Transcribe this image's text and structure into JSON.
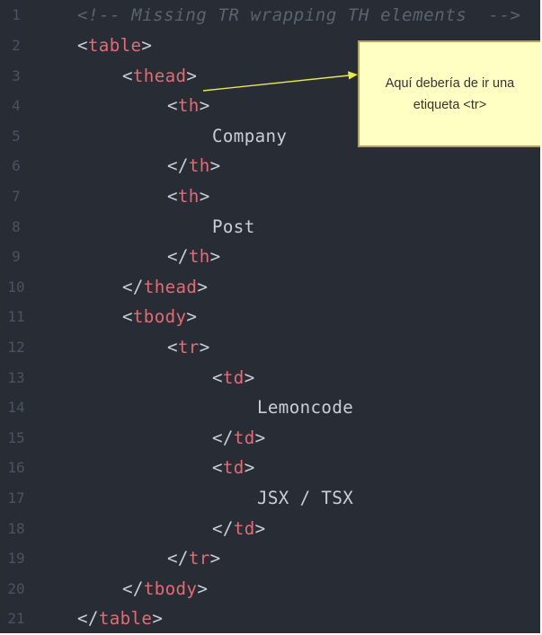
{
  "editor": {
    "lines": [
      {
        "n": "1",
        "indent": 0,
        "kind": "comment",
        "text": "<!-- Missing TR wrapping TH elements  -->"
      },
      {
        "n": "2",
        "indent": 0,
        "kind": "open",
        "tag": "table"
      },
      {
        "n": "3",
        "indent": 1,
        "kind": "open",
        "tag": "thead"
      },
      {
        "n": "4",
        "indent": 2,
        "kind": "open",
        "tag": "th"
      },
      {
        "n": "5",
        "indent": 3,
        "kind": "text",
        "text": "Company"
      },
      {
        "n": "6",
        "indent": 2,
        "kind": "close",
        "tag": "th"
      },
      {
        "n": "7",
        "indent": 2,
        "kind": "open",
        "tag": "th"
      },
      {
        "n": "8",
        "indent": 3,
        "kind": "text",
        "text": "Post"
      },
      {
        "n": "9",
        "indent": 2,
        "kind": "close",
        "tag": "th"
      },
      {
        "n": "10",
        "indent": 1,
        "kind": "close",
        "tag": "thead"
      },
      {
        "n": "11",
        "indent": 1,
        "kind": "open",
        "tag": "tbody"
      },
      {
        "n": "12",
        "indent": 2,
        "kind": "open",
        "tag": "tr"
      },
      {
        "n": "13",
        "indent": 3,
        "kind": "open",
        "tag": "td"
      },
      {
        "n": "14",
        "indent": 4,
        "kind": "text",
        "text": "Lemoncode"
      },
      {
        "n": "15",
        "indent": 3,
        "kind": "close",
        "tag": "td"
      },
      {
        "n": "16",
        "indent": 3,
        "kind": "open",
        "tag": "td"
      },
      {
        "n": "17",
        "indent": 4,
        "kind": "text",
        "text": "JSX / TSX"
      },
      {
        "n": "18",
        "indent": 3,
        "kind": "close",
        "tag": "td"
      },
      {
        "n": "19",
        "indent": 2,
        "kind": "close",
        "tag": "tr"
      },
      {
        "n": "20",
        "indent": 1,
        "kind": "close",
        "tag": "tbody"
      },
      {
        "n": "21",
        "indent": 0,
        "kind": "close",
        "tag": "table"
      }
    ]
  },
  "callout": {
    "line1": "Aquí debería de ir una",
    "line2": "etiqueta <tr>"
  },
  "colors": {
    "background": "#282c34",
    "tag": "#e06c75",
    "punctuation": "#c9ced8",
    "comment": "#5c6370",
    "line_number": "#4b5263",
    "callout_fill": "#ffffc4",
    "callout_border": "#b6a255",
    "arrow": "#e8e84a"
  }
}
